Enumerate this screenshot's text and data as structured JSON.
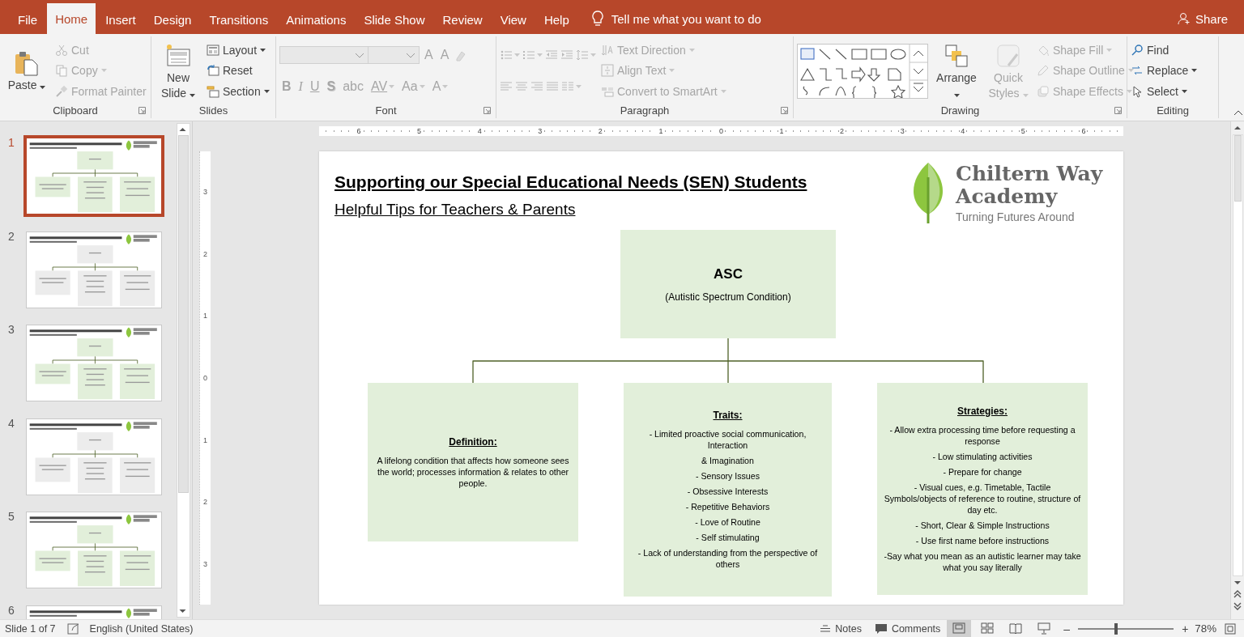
{
  "tabs": [
    {
      "label": "File",
      "selected": false
    },
    {
      "label": "Home",
      "selected": true
    },
    {
      "label": "Insert",
      "selected": false
    },
    {
      "label": "Design",
      "selected": false
    },
    {
      "label": "Transitions",
      "selected": false
    },
    {
      "label": "Animations",
      "selected": false
    },
    {
      "label": "Slide Show",
      "selected": false
    },
    {
      "label": "Review",
      "selected": false
    },
    {
      "label": "View",
      "selected": false
    },
    {
      "label": "Help",
      "selected": false
    }
  ],
  "tell_me": {
    "placeholder": "Tell me what you want to do"
  },
  "share": "Share",
  "ribbon": {
    "groups": [
      {
        "label": "Clipboard",
        "launcher": true,
        "columns": [
          [
            [
              {
                "kind": "large",
                "label": "Paste",
                "disabled": false,
                "menu": true
              }
            ]
          ],
          [
            [
              {
                "kind": "small",
                "label": "Cut",
                "disabled": true,
                "menu": false
              }
            ],
            [
              {
                "kind": "small",
                "label": "Copy",
                "disabled": true,
                "menu": true
              }
            ],
            [
              {
                "kind": "small",
                "label": "Format Painter",
                "disabled": true,
                "menu": false
              }
            ]
          ]
        ]
      },
      {
        "label": "Slides",
        "launcher": false,
        "columns": [
          [
            [
              {
                "kind": "large",
                "label": "New Slide",
                "disabled": false,
                "menu": true
              }
            ]
          ],
          [
            [
              {
                "kind": "small",
                "label": "Layout",
                "disabled": false,
                "menu": true
              }
            ],
            [
              {
                "kind": "small",
                "label": "Reset",
                "disabled": false,
                "menu": false
              }
            ],
            [
              {
                "kind": "small",
                "label": "Section",
                "disabled": false,
                "menu": true
              }
            ]
          ]
        ]
      },
      {
        "label": "Font",
        "launcher": true,
        "columns": [
          [
            [
              {
                "kind": "combo",
                "disabled": true
              },
              {
                "kind": "combo",
                "disabled": true
              },
              {
                "kind": "grow",
                "label": "A",
                "disabled": true,
                "menu": false
              },
              {
                "kind": "shrink",
                "label": "A",
                "disabled": true,
                "menu": false
              },
              {
                "kind": "icon",
                "disabled": true,
                "menu": false
              }
            ],
            [
              {
                "kind": "bold",
                "label": "B",
                "disabled": true,
                "menu": false
              },
              {
                "kind": "italic",
                "label": "I",
                "disabled": true,
                "menu": false
              },
              {
                "kind": "underline",
                "label": "U",
                "disabled": true,
                "menu": false
              },
              {
                "kind": "shadow",
                "label": "S",
                "disabled": true,
                "menu": false
              },
              {
                "kind": "strike",
                "label": "abc",
                "disabled": true,
                "menu": false
              },
              {
                "kind": "spacing",
                "label": "AV",
                "disabled": true,
                "menu": true
              },
              {
                "kind": "case",
                "label": "Aa",
                "disabled": true,
                "menu": true
              },
              {
                "kind": "color",
                "label": "A",
                "disabled": true,
                "menu": true
              }
            ]
          ]
        ]
      },
      {
        "label": "Paragraph",
        "launcher": true,
        "columns": [
          [
            [
              {
                "kind": "icon",
                "disabled": true,
                "menu": true
              },
              {
                "kind": "icon",
                "disabled": true,
                "menu": true
              },
              {
                "kind": "icon",
                "disabled": true,
                "menu": false
              },
              {
                "kind": "icon",
                "disabled": true,
                "menu": false
              },
              {
                "kind": "icon",
                "disabled": true,
                "menu": true
              }
            ],
            [
              {
                "kind": "icon",
                "disabled": true,
                "menu": false
              },
              {
                "kind": "icon",
                "disabled": true,
                "menu": false
              },
              {
                "kind": "icon",
                "disabled": true,
                "menu": false
              },
              {
                "kind": "icon",
                "disabled": true,
                "menu": false
              },
              {
                "kind": "icon",
                "disabled": true,
                "menu": true
              }
            ]
          ],
          [
            [
              {
                "kind": "small",
                "label": "Text Direction",
                "disabled": true,
                "menu": true
              }
            ],
            [
              {
                "kind": "small",
                "label": "Align Text",
                "disabled": true,
                "menu": true
              }
            ],
            [
              {
                "kind": "small",
                "label": "Convert to SmartArt",
                "disabled": true,
                "menu": true
              }
            ]
          ]
        ]
      },
      {
        "label": "Drawing",
        "launcher": true,
        "columns": [
          [
            [
              {
                "kind": "gallery"
              }
            ]
          ],
          [
            [
              {
                "kind": "large",
                "label": "Arrange",
                "disabled": false,
                "menu": true
              }
            ]
          ],
          [
            [
              {
                "kind": "large",
                "label": "Quick Styles",
                "disabled": true,
                "menu": true
              }
            ]
          ],
          [
            [
              {
                "kind": "small",
                "label": "Shape Fill",
                "disabled": true,
                "menu": true
              }
            ],
            [
              {
                "kind": "small",
                "label": "Shape Outline",
                "disabled": true,
                "menu": true
              }
            ],
            [
              {
                "kind": "small",
                "label": "Shape Effects",
                "disabled": true,
                "menu": true
              }
            ]
          ]
        ]
      },
      {
        "label": "Editing",
        "launcher": false,
        "columns": [
          [
            [
              {
                "kind": "small",
                "label": "Find",
                "disabled": false,
                "menu": false
              }
            ],
            [
              {
                "kind": "small",
                "label": "Replace",
                "disabled": false,
                "menu": true
              }
            ],
            [
              {
                "kind": "small",
                "label": "Select",
                "disabled": false,
                "menu": true
              }
            ]
          ]
        ]
      }
    ]
  },
  "slides": [
    {
      "number": "1",
      "selected": true,
      "color": "#e2efda"
    },
    {
      "number": "2",
      "selected": false,
      "color": "#ececec"
    },
    {
      "number": "3",
      "selected": false,
      "color": "#e2efda"
    },
    {
      "number": "4",
      "selected": false,
      "color": "#ececec"
    },
    {
      "number": "5",
      "selected": false,
      "color": "#e2efda"
    },
    {
      "number": "6",
      "selected": false
    }
  ],
  "rulers": {
    "horizontal": [
      "6",
      "5",
      "4",
      "3",
      "2",
      "1",
      "0",
      "1",
      "2",
      "3",
      "4",
      "5",
      "6"
    ],
    "vertical": [
      "3",
      "2",
      "1",
      "0",
      "1",
      "2",
      "3"
    ]
  },
  "slide": {
    "title": "Supporting our Special Educational Needs (SEN) Students",
    "subtitle": "Helpful Tips for Teachers & Parents",
    "logo": {
      "lines": [
        "Chiltern Way",
        "Academy"
      ],
      "tagline": "Turning Futures Around"
    },
    "root": {
      "heading": "ASC",
      "text": "(Autistic Spectrum Condition)"
    },
    "branches": [
      {
        "heading": "Definition:",
        "lines": [
          "A lifelong condition that affects how someone sees the world; processes information & relates to other people."
        ]
      },
      {
        "heading": "Traits:",
        "lines": [
          "- Limited proactive social communication, Interaction",
          "& Imagination",
          "- Sensory Issues",
          "- Obsessive Interests",
          "- Repetitive Behaviors",
          "- Love of Routine",
          "- Self stimulating",
          "- Lack of understanding from the perspective of others"
        ]
      },
      {
        "heading": "Strategies:",
        "lines": [
          "- Allow extra processing time before requesting a response",
          "- Low stimulating activities",
          "- Prepare for change",
          "- Visual cues, e.g. Timetable, Tactile Symbols/objects of reference to routine, structure of day etc.",
          "- Short, Clear & Simple Instructions",
          "- Use first name before instructions",
          "-Say what you mean as an autistic learner may take what you say literally"
        ]
      }
    ]
  },
  "status_bar": {
    "slide_info": "Slide 1 of 7",
    "language": "English (United States)",
    "notes": "Notes",
    "comments": "Comments",
    "views": [
      {
        "selected": true
      },
      {
        "selected": false
      },
      {
        "selected": false
      },
      {
        "selected": false
      }
    ],
    "zoom": {
      "minus": "–",
      "plus": "+",
      "level": 0.4,
      "value": "78%"
    }
  }
}
